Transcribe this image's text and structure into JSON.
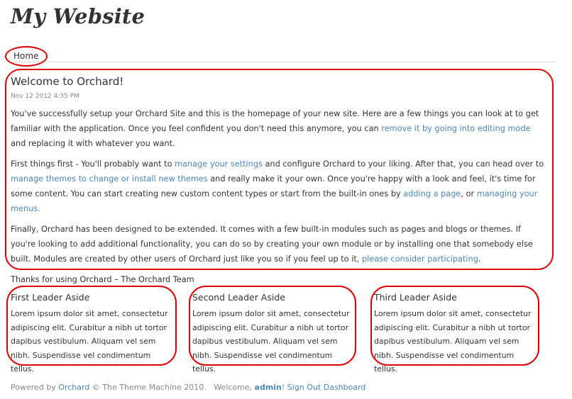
{
  "site": {
    "title": "My Website"
  },
  "nav": {
    "home": "Home"
  },
  "content": {
    "title": "Welcome to Orchard!",
    "date": "Nov 12 2012 4:35 PM",
    "p1": {
      "a": "You've successfully setup your Orchard Site and this is the homepage of your new site. Here are a few things you can look at to get familiar with the application. Once you feel confident you don't need this anymore, you can ",
      "link": "remove it by going into editing mode",
      "b": " and replacing it with whatever you want."
    },
    "p2": {
      "a": "First things first - You'll probably want to ",
      "link1": "manage your settings",
      "b": " and configure Orchard to your liking. After that, you can head over to ",
      "link2": "manage themes to change or install new themes",
      "c": " and really make it your own. Once you're happy with a look and feel, it's time for some content. You can start creating new custom content types or start from the built-in ones by ",
      "link3": "adding a page",
      "d": ", or ",
      "link4": "managing your menus.",
      "e": ""
    },
    "p3": {
      "a": "Finally, Orchard has been designed to be extended. It comes with a few built-in modules such as pages and blogs or themes. If you're looking to add additional functionality, you can do so by creating your own module or by installing one that somebody else built. Modules are created by other users of Orchard just like you so if you feel up to it, ",
      "link": "please consider participating",
      "b": "."
    },
    "p4": "Thanks for using Orchard – The Orchard Team"
  },
  "asides": [
    {
      "title": "First Leader Aside",
      "text": "Lorem ipsum dolor sit amet, consectetur adipiscing elit. Curabitur a nibh ut tortor dapibus vestibulum. Aliquam vel sem nibh. Suspendisse vel condimentum tellus."
    },
    {
      "title": "Second Leader Aside",
      "text": "Lorem ipsum dolor sit amet, consectetur adipiscing elit. Curabitur a nibh ut tortor dapibus vestibulum. Aliquam vel sem nibh. Suspendisse vel condimentum tellus."
    },
    {
      "title": "Third Leader Aside",
      "text": "Lorem ipsum dolor sit amet, consectetur adipiscing elit. Curabitur a nibh ut tortor dapibus vestibulum. Aliquam vel sem nibh. Suspendisse vel condimentum tellus."
    }
  ],
  "footer": {
    "powered": "Powered by ",
    "orchard": "Orchard",
    "copy": " © The Theme Machine 2010.   Welcome, ",
    "user": "admin",
    "bang": "! ",
    "signout": "Sign Out",
    "dashboard": "Dashboard"
  },
  "colors": {
    "link": "#4d86b3",
    "annotation": "#e00000",
    "text": "#333333",
    "muted": "#888888"
  }
}
